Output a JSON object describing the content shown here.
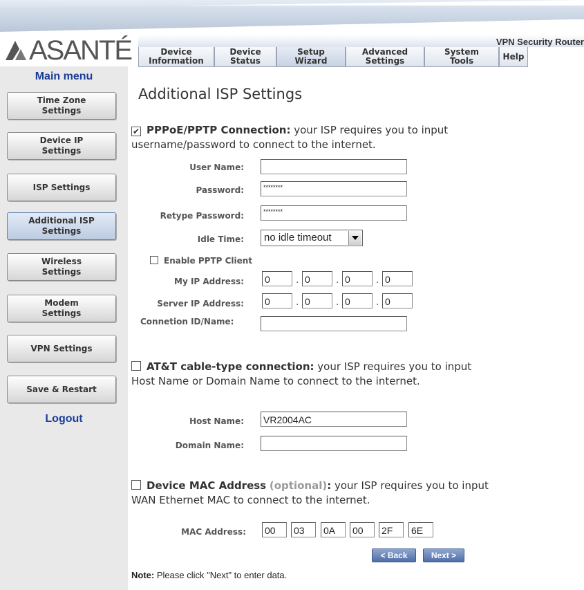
{
  "header": {
    "product": "VPN Security Router",
    "brand": "ASANTÉ"
  },
  "tabs": [
    {
      "l1": "Device",
      "l2": "Information"
    },
    {
      "l1": "Device",
      "l2": "Status"
    },
    {
      "l1": "Setup",
      "l2": "Wizard"
    },
    {
      "l1": "Advanced",
      "l2": "Settings"
    },
    {
      "l1": "System",
      "l2": "Tools"
    },
    {
      "l1": "Help",
      "l2": ""
    }
  ],
  "sidebar": {
    "title": "Main menu",
    "items": [
      {
        "l1": "Time Zone",
        "l2": "Settings"
      },
      {
        "l1": "Device IP",
        "l2": "Settings"
      },
      {
        "l1": "ISP Settings",
        "l2": ""
      },
      {
        "l1": "Additional ISP",
        "l2": "Settings"
      },
      {
        "l1": "Wireless",
        "l2": "Settings"
      },
      {
        "l1": "Modem",
        "l2": "Settings"
      },
      {
        "l1": "VPN Settings",
        "l2": ""
      },
      {
        "l1": "Save & Restart",
        "l2": ""
      }
    ],
    "logout": "Logout"
  },
  "page": {
    "title": "Additional ISP Settings",
    "pppoe": {
      "checked": true,
      "heading": "PPPoE/PPTP Connection:",
      "desc1": " your ISP requires you to input",
      "desc2": "username/password to connect to the internet.",
      "user_label": "User Name:",
      "user_value": "",
      "pass_label": "Password:",
      "pass_value": "********",
      "repass_label": "Retype Password:",
      "repass_value": "********",
      "idle_label": "Idle Time:",
      "idle_value": "no idle timeout",
      "pptp_label": "Enable PPTP Client",
      "myip_label": "My IP Address:",
      "myip": [
        "0",
        "0",
        "0",
        "0"
      ],
      "serverip_label": "Server IP Address:",
      "serverip": [
        "0",
        "0",
        "0",
        "0"
      ],
      "connid_label": "Connetion ID/Name:",
      "connid_value": ""
    },
    "att": {
      "heading": "AT&T cable-type connection:",
      "desc1": " your ISP requires you to input",
      "desc2": "Host Name or Domain Name to connect to the internet.",
      "host_label": "Host Name:",
      "host_value": "VR2004AC",
      "domain_label": "Domain Name:",
      "domain_value": ""
    },
    "mac": {
      "heading": "Device MAC Address",
      "optional": "(optional)",
      "colon": ":",
      "desc1": " your ISP requires you to input",
      "desc2": "WAN Ethernet MAC to connect to the internet.",
      "label": "MAC Address:",
      "values": [
        "00",
        "03",
        "0A",
        "00",
        "2F",
        "6E"
      ]
    },
    "back": "< Back",
    "next": "Next >",
    "note_bold": "Note:",
    "note_text": " Please click \"Next\" to enter data."
  }
}
